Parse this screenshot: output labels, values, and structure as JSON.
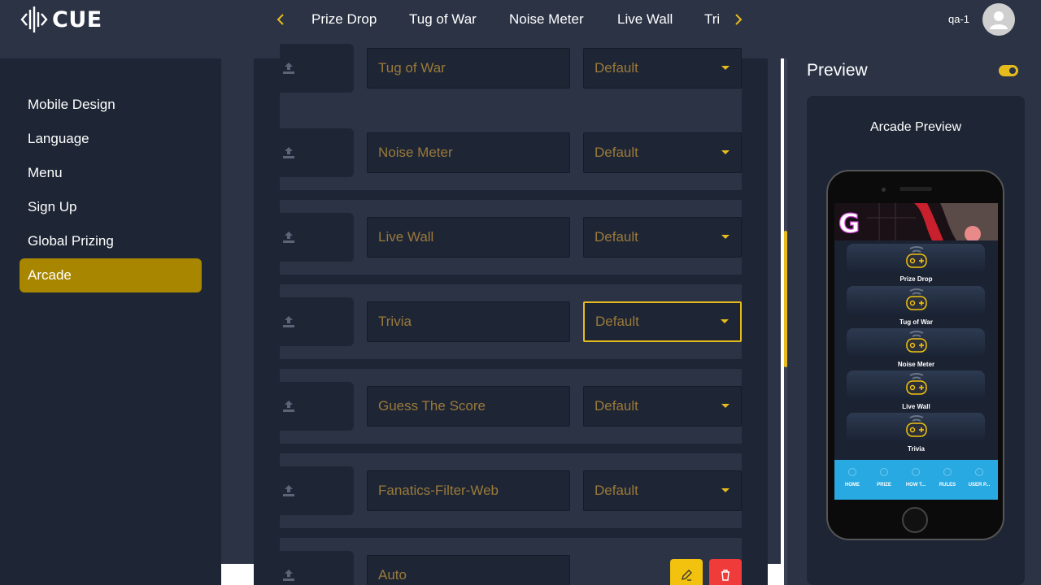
{
  "app": {
    "logo_text": "CUE"
  },
  "nav": {
    "tabs": [
      "Prize Drop",
      "Tug of War",
      "Noise Meter",
      "Live Wall",
      "Tri"
    ]
  },
  "user": {
    "name": "qa-1"
  },
  "sidebar": {
    "items": [
      "Mobile Design",
      "Language",
      "Menu",
      "Sign Up",
      "Global Prizing",
      "Arcade"
    ],
    "active": "Arcade"
  },
  "arcade_rows": [
    {
      "name": "Tug of War",
      "type": "Default"
    },
    {
      "name": "Noise Meter",
      "type": "Default"
    },
    {
      "name": "Live Wall",
      "type": "Default"
    },
    {
      "name": "Trivia",
      "type": "Default"
    },
    {
      "name": "Guess The Score",
      "type": "Default"
    },
    {
      "name": "Fanatics-Filter-Web",
      "type": "Default"
    },
    {
      "name": "Auto",
      "type": ""
    }
  ],
  "preview": {
    "title": "Preview",
    "card_title": "Arcade Preview",
    "banner_letter": "G",
    "games": [
      "Prize Drop",
      "Tug of War",
      "Noise Meter",
      "Live Wall",
      "Trivia"
    ],
    "bottom_nav": [
      "HOME",
      "PRIZE",
      "HOW T...",
      "RULES",
      "USER P..."
    ]
  },
  "colors": {
    "accent": "#e6bc1c",
    "active_sidebar": "#a88600",
    "danger": "#f03b3b",
    "nav_blue": "#29a9e1"
  }
}
